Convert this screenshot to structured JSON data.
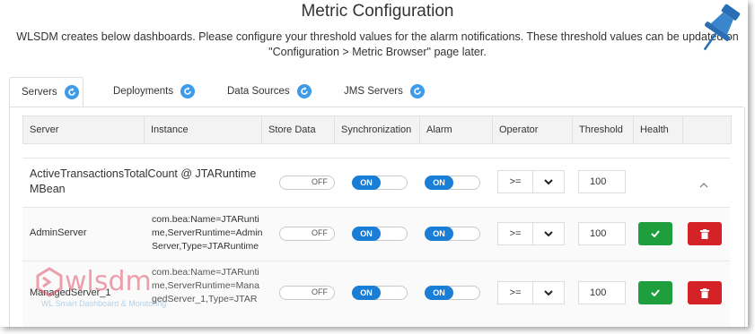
{
  "header": {
    "title": "Metric Configuration",
    "description_line1": "WLSDM creates below dashboards. Please configure your threshold values for the alarm notifications. These threshold values can be updated on",
    "description_line2": "\"Configuration > Metric Browser\" page later."
  },
  "tabs": [
    {
      "label": "Servers",
      "active": true
    },
    {
      "label": "Deployments",
      "active": false
    },
    {
      "label": "Data Sources",
      "active": false
    },
    {
      "label": "JMS Servers",
      "active": false
    }
  ],
  "table": {
    "columns": [
      "Server",
      "Instance",
      "Store Data",
      "Synchronization",
      "Alarm",
      "Operator",
      "Threshold",
      "Health"
    ],
    "metric": {
      "name_line1": "ActiveTransactionsTotalCount @ JTARuntime",
      "name_line2": "MBean",
      "store_data": "OFF",
      "synchronization": "ON",
      "alarm": "ON",
      "operator": ">=",
      "threshold": "100"
    },
    "rows": [
      {
        "server": "AdminServer",
        "instance_line1": "com.bea:Name=JTARunti",
        "instance_line2": "me,ServerRuntime=Admin",
        "instance_line3": "Server,Type=JTARuntime",
        "store_data": "OFF",
        "synchronization": "ON",
        "alarm": "ON",
        "operator": ">=",
        "threshold": "100"
      },
      {
        "server": "ManagedServer_1",
        "instance_line1": "com.bea:Name=JTARunti",
        "instance_line2": "me,ServerRuntime=Mana",
        "instance_line3": "gedServer_1,Type=JTAR",
        "store_data": "OFF",
        "synchronization": "ON",
        "alarm": "ON",
        "operator": ">=",
        "threshold": "100"
      }
    ]
  },
  "watermark": {
    "logo_text": "wlsdm",
    "tagline": "WL Smart Dashboard & Monitoring"
  },
  "colors": {
    "toggle_on": "#1a7dd6",
    "health_ok": "#1e9e3d",
    "delete": "#d42227",
    "tab_icon": "#3d9be9"
  }
}
